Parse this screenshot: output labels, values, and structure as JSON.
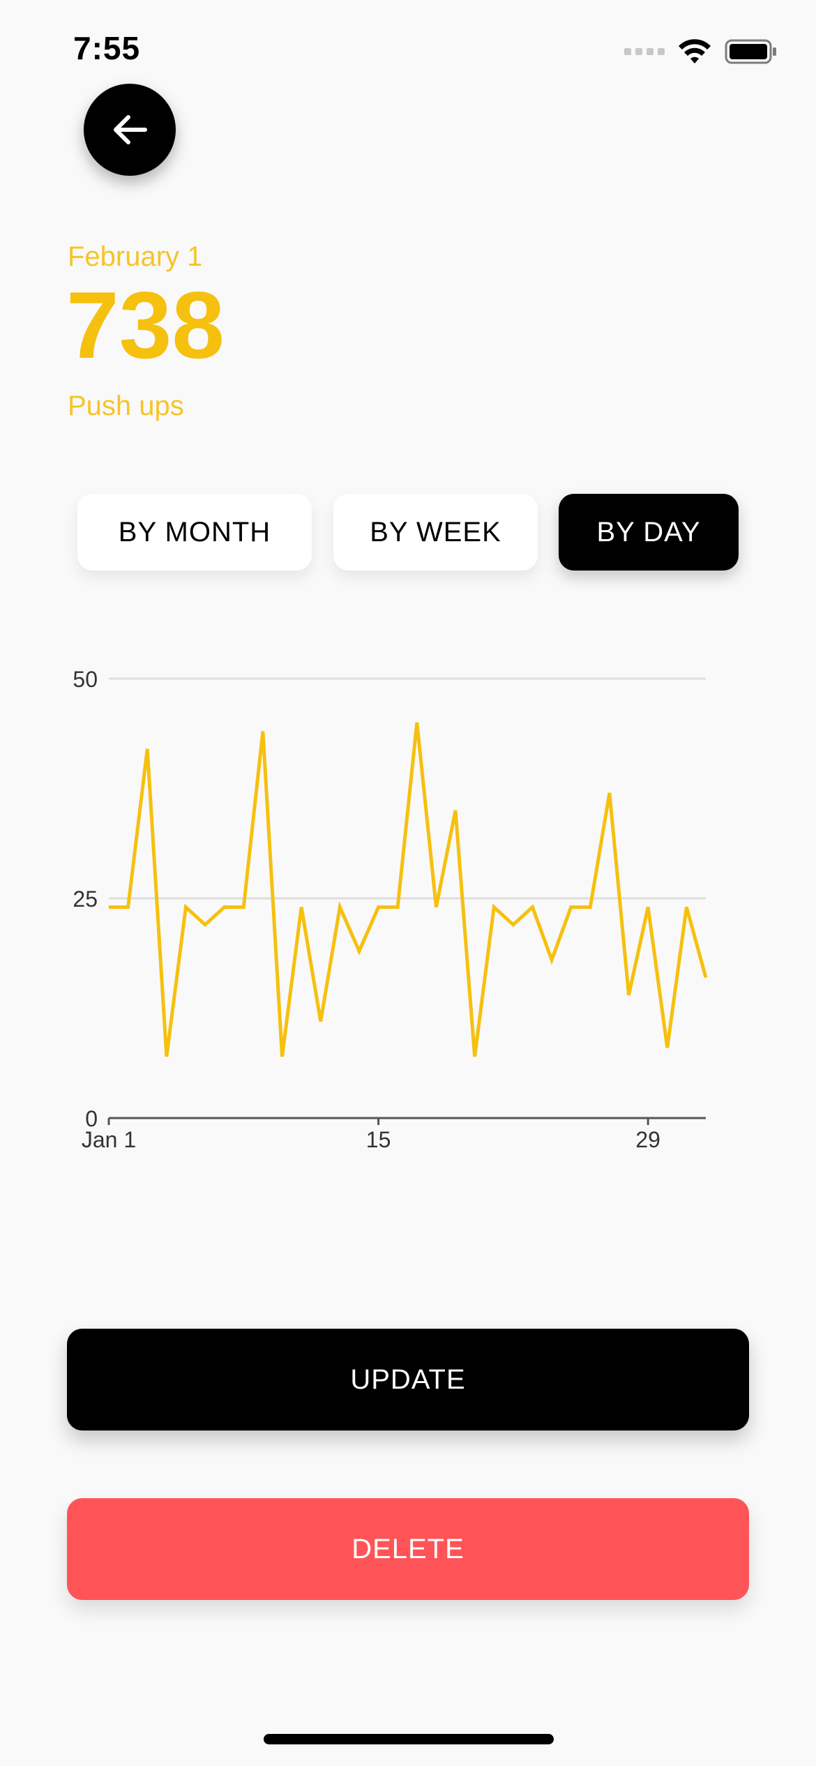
{
  "status_bar": {
    "time": "7:55"
  },
  "header": {
    "date": "February 1",
    "count": "738",
    "unit": "Push ups"
  },
  "range_tabs": {
    "items": [
      {
        "label": "BY MONTH",
        "active": false
      },
      {
        "label": "BY WEEK",
        "active": false
      },
      {
        "label": "BY DAY",
        "active": true
      }
    ]
  },
  "actions": {
    "update_label": "UPDATE",
    "delete_label": "DELETE"
  },
  "colors": {
    "accent": "#f6c00f",
    "delete": "#ff5457",
    "dark": "#000000"
  },
  "icons": {
    "back": "arrow-left-icon",
    "wifi": "wifi-icon",
    "battery": "battery-icon",
    "signal": "signal-icon"
  },
  "chart_data": {
    "type": "line",
    "x_tick_labels": [
      "Jan 1",
      "15",
      "29"
    ],
    "x_ticks": [
      1,
      15,
      29
    ],
    "y_ticks": [
      0,
      25,
      50
    ],
    "ylim": [
      0,
      50
    ],
    "xlim": [
      1,
      32
    ],
    "grid": true,
    "line_color": "#f6c00f",
    "series": [
      {
        "x": [
          1,
          2,
          3,
          4,
          5,
          6,
          7,
          8,
          9,
          10,
          11,
          12,
          13,
          14,
          15,
          16,
          17,
          18,
          19,
          20,
          21,
          22,
          23,
          24,
          25,
          26,
          27,
          28,
          29,
          30,
          31,
          32
        ],
        "values": [
          24,
          24,
          42,
          7,
          24,
          22,
          24,
          24,
          44,
          7,
          24,
          11,
          24,
          19,
          24,
          24,
          45,
          24,
          35,
          7,
          24,
          22,
          24,
          18,
          24,
          24,
          37,
          14,
          24,
          8,
          24,
          16
        ]
      }
    ]
  }
}
